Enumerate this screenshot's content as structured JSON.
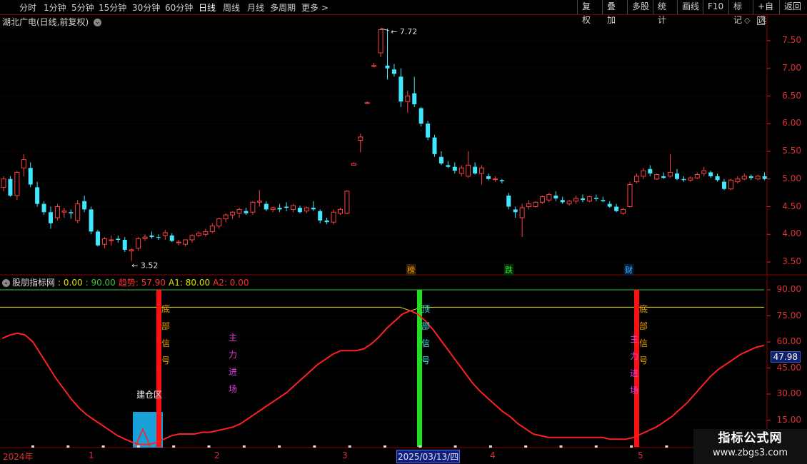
{
  "toolbar": {
    "left_items": [
      "分时",
      "1分钟",
      "5分钟",
      "15分钟",
      "30分钟",
      "60分钟",
      "日线",
      "周线",
      "月线",
      "多周期",
      "更多 >"
    ],
    "active": "日线",
    "right_items": [
      "复权",
      "叠加",
      "多股",
      "统计",
      "画线",
      "F10",
      "标记",
      "+自选",
      "返回"
    ]
  },
  "stock": {
    "title": "湖北广电(日线,前复权)",
    "chevron_icon": "chevron-down-icon",
    "diamond_icon": "diamond-icon"
  },
  "price_axis": {
    "labels": [
      "7.50",
      "7.00",
      "6.50",
      "6.00",
      "5.50",
      "5.00",
      "4.50",
      "4.00",
      "3.50"
    ]
  },
  "price_annotations": {
    "high": "7.72",
    "low": "3.52"
  },
  "event_tags": [
    {
      "text": "榜",
      "color": "#e8a000",
      "bg": "#3a2200"
    },
    {
      "text": "跌",
      "color": "#40e040",
      "bg": "#003000"
    },
    {
      "text": "财",
      "color": "#40c0ff",
      "bg": "#002040"
    }
  ],
  "indicator": {
    "name": "股朋指标网",
    "v0": ": 0.00",
    "v90": ": 90.00",
    "trend_label": "趋势: 57.90",
    "a1_label": "A1: 80.00",
    "a2_label": "A2: 0.00",
    "axis_labels": [
      "90.00",
      "75.00",
      "60.00",
      "45.00",
      "30.00",
      "15.00"
    ],
    "current_value": "47.98",
    "signals": [
      {
        "text": "底部信号",
        "color": "#e8a000"
      },
      {
        "text": "顶部信号",
        "color": "#40e0e0"
      },
      {
        "text": "底部信号",
        "color": "#e8a000"
      }
    ],
    "main_force": "主力进场",
    "main_force_color": "#e040e0",
    "build_zone": "建仓区"
  },
  "colors": {
    "up": "#ff4040",
    "down": "#40e8ff",
    "trend": "#ff2020",
    "buy_bar": "#ff1010",
    "sell_bar": "#20e020",
    "a1": "#e0e000",
    "top_line": "#40c040"
  },
  "date_axis": {
    "labels": [
      "2024年",
      "1",
      "2",
      "3",
      "4",
      "5"
    ],
    "highlight": "2025/03/13/四"
  },
  "watermark": {
    "title": "指标公式网",
    "url": "www.zbgs3.com"
  },
  "chart_data": {
    "type": "candlestick",
    "title": "湖北广电(日线,前复权)",
    "ylim": [
      3.3,
      7.85
    ],
    "candles": [
      [
        4.85,
        5.05,
        4.78,
        5.0
      ],
      [
        5.0,
        5.05,
        4.68,
        4.7
      ],
      [
        4.7,
        5.15,
        4.62,
        5.12
      ],
      [
        5.2,
        5.45,
        5.05,
        5.35
      ],
      [
        5.2,
        5.3,
        4.85,
        4.9
      ],
      [
        4.85,
        4.95,
        4.5,
        4.55
      ],
      [
        4.55,
        4.6,
        4.35,
        4.4
      ],
      [
        4.4,
        4.5,
        4.1,
        4.2
      ],
      [
        4.3,
        4.55,
        4.25,
        4.5
      ],
      [
        4.4,
        4.48,
        4.3,
        4.42
      ],
      [
        4.4,
        4.45,
        4.28,
        4.38
      ],
      [
        4.25,
        4.62,
        4.2,
        4.55
      ],
      [
        4.6,
        4.7,
        4.4,
        4.45
      ],
      [
        4.45,
        4.5,
        4.0,
        4.05
      ],
      [
        4.05,
        4.08,
        3.78,
        3.8
      ],
      [
        3.82,
        3.95,
        3.75,
        3.92
      ],
      [
        3.9,
        3.98,
        3.8,
        3.9
      ],
      [
        3.92,
        3.98,
        3.85,
        3.9
      ],
      [
        3.9,
        3.95,
        3.68,
        3.72
      ],
      [
        3.7,
        3.75,
        3.52,
        3.72
      ],
      [
        3.75,
        3.95,
        3.7,
        3.92
      ],
      [
        3.92,
        4.0,
        3.88,
        3.95
      ],
      [
        3.98,
        4.05,
        3.92,
        3.95
      ],
      [
        3.95,
        4.0,
        3.9,
        3.94
      ],
      [
        3.98,
        4.08,
        3.9,
        4.03
      ],
      [
        3.98,
        4.02,
        3.86,
        3.88
      ],
      [
        3.85,
        3.9,
        3.8,
        3.86
      ],
      [
        3.82,
        3.9,
        3.78,
        3.9
      ],
      [
        3.9,
        4.0,
        3.85,
        3.98
      ],
      [
        3.98,
        4.05,
        3.95,
        4.02
      ],
      [
        4.0,
        4.1,
        3.96,
        4.05
      ],
      [
        4.05,
        4.2,
        4.02,
        4.15
      ],
      [
        4.15,
        4.3,
        4.1,
        4.28
      ],
      [
        4.28,
        4.38,
        4.22,
        4.35
      ],
      [
        4.35,
        4.42,
        4.28,
        4.4
      ],
      [
        4.38,
        4.48,
        4.3,
        4.45
      ],
      [
        4.42,
        4.48,
        4.35,
        4.38
      ],
      [
        4.4,
        4.6,
        4.35,
        4.58
      ],
      [
        4.58,
        4.8,
        4.5,
        4.6
      ],
      [
        4.55,
        4.6,
        4.42,
        4.45
      ],
      [
        4.45,
        4.5,
        4.4,
        4.48
      ],
      [
        4.48,
        4.55,
        4.4,
        4.45
      ],
      [
        4.5,
        4.58,
        4.42,
        4.48
      ],
      [
        4.45,
        4.55,
        4.4,
        4.52
      ],
      [
        4.48,
        4.52,
        4.38,
        4.4
      ],
      [
        4.42,
        4.5,
        4.38,
        4.48
      ],
      [
        4.48,
        4.6,
        4.42,
        4.45
      ],
      [
        4.42,
        4.45,
        4.2,
        4.25
      ],
      [
        4.25,
        4.3,
        4.18,
        4.22
      ],
      [
        4.22,
        4.45,
        4.18,
        4.4
      ],
      [
        4.38,
        4.48,
        4.35,
        4.45
      ],
      [
        4.38,
        4.8,
        4.36,
        4.78
      ],
      [
        5.25,
        5.3,
        5.25,
        5.28
      ],
      [
        5.7,
        5.82,
        5.48,
        5.76
      ],
      [
        6.38,
        6.4,
        6.36,
        6.38
      ],
      [
        7.05,
        7.1,
        7.02,
        7.05
      ],
      [
        7.28,
        7.72,
        7.2,
        7.7
      ],
      [
        7.05,
        7.72,
        6.8,
        7.0
      ],
      [
        6.98,
        7.08,
        6.85,
        6.9
      ],
      [
        6.85,
        7.0,
        6.3,
        6.4
      ],
      [
        6.4,
        6.6,
        6.2,
        6.5
      ],
      [
        6.55,
        6.85,
        6.3,
        6.35
      ],
      [
        6.28,
        6.3,
        5.95,
        6.0
      ],
      [
        6.0,
        6.05,
        5.7,
        5.75
      ],
      [
        5.75,
        5.8,
        5.4,
        5.45
      ],
      [
        5.4,
        5.5,
        5.25,
        5.28
      ],
      [
        5.25,
        5.32,
        5.2,
        5.22
      ],
      [
        5.22,
        5.3,
        5.1,
        5.15
      ],
      [
        5.1,
        5.25,
        5.05,
        5.2
      ],
      [
        5.05,
        5.5,
        5.02,
        5.25
      ],
      [
        5.22,
        5.3,
        5.08,
        5.1
      ],
      [
        5.1,
        5.25,
        4.9,
        5.2
      ],
      [
        5.05,
        5.1,
        4.98,
        5.0
      ],
      [
        5.0,
        5.05,
        4.95,
        5.0
      ],
      [
        4.98,
        5.0,
        4.92,
        4.96
      ],
      [
        4.7,
        4.75,
        4.45,
        4.5
      ],
      [
        4.45,
        4.5,
        4.3,
        4.4
      ],
      [
        4.3,
        4.55,
        3.95,
        4.48
      ],
      [
        4.5,
        4.62,
        4.45,
        4.55
      ],
      [
        4.5,
        4.6,
        4.48,
        4.58
      ],
      [
        4.58,
        4.7,
        4.55,
        4.68
      ],
      [
        4.62,
        4.75,
        4.58,
        4.72
      ],
      [
        4.7,
        4.78,
        4.6,
        4.65
      ],
      [
        4.62,
        4.68,
        4.55,
        4.58
      ],
      [
        4.55,
        4.62,
        4.52,
        4.6
      ],
      [
        4.6,
        4.7,
        4.55,
        4.65
      ],
      [
        4.65,
        4.72,
        4.58,
        4.62
      ],
      [
        4.6,
        4.7,
        4.58,
        4.68
      ],
      [
        4.66,
        4.72,
        4.6,
        4.64
      ],
      [
        4.62,
        4.68,
        4.58,
        4.6
      ],
      [
        4.55,
        4.6,
        4.48,
        4.5
      ],
      [
        4.5,
        4.55,
        4.4,
        4.42
      ],
      [
        4.38,
        4.48,
        4.35,
        4.45
      ],
      [
        4.5,
        4.95,
        4.48,
        4.9
      ],
      [
        4.95,
        5.1,
        4.92,
        5.05
      ],
      [
        5.05,
        5.2,
        5.0,
        5.15
      ],
      [
        5.18,
        5.25,
        5.05,
        5.1
      ],
      [
        5.0,
        5.1,
        4.98,
        5.08
      ],
      [
        5.05,
        5.12,
        5.0,
        5.02
      ],
      [
        5.05,
        5.45,
        5.02,
        5.12
      ],
      [
        5.1,
        5.18,
        4.98,
        5.0
      ],
      [
        5.0,
        5.05,
        4.95,
        4.98
      ],
      [
        4.98,
        5.05,
        4.95,
        5.02
      ],
      [
        5.02,
        5.12,
        5.0,
        5.08
      ],
      [
        5.1,
        5.22,
        5.05,
        5.15
      ],
      [
        5.12,
        5.15,
        5.02,
        5.05
      ],
      [
        5.05,
        5.1,
        4.95,
        4.98
      ],
      [
        4.95,
        5.0,
        4.8,
        4.82
      ],
      [
        4.82,
        5.0,
        4.8,
        4.98
      ],
      [
        4.95,
        5.05,
        4.92,
        5.0
      ],
      [
        5.0,
        5.1,
        4.98,
        5.05
      ],
      [
        5.05,
        5.08,
        4.98,
        5.02
      ],
      [
        5.0,
        5.08,
        4.98,
        5.05
      ],
      [
        5.05,
        5.12,
        4.98,
        5.0
      ]
    ],
    "indicator_series": {
      "name": "趋势",
      "values": [
        62,
        64,
        65,
        64,
        60,
        53,
        46,
        39,
        33,
        27,
        22,
        18,
        15,
        12,
        9,
        6,
        4,
        2,
        1,
        1,
        2,
        4,
        6,
        7,
        7,
        7,
        8,
        8,
        9,
        10,
        11,
        13,
        16,
        19,
        22,
        25,
        28,
        31,
        35,
        39,
        43,
        47,
        50,
        53,
        55,
        55,
        55,
        56,
        59,
        63,
        68,
        72,
        76,
        78,
        76,
        72,
        67,
        61,
        55,
        49,
        43,
        37,
        32,
        28,
        24,
        20,
        17,
        13,
        10,
        7,
        6,
        5,
        5,
        5,
        5,
        5,
        5,
        5,
        5,
        4,
        4,
        4,
        5,
        7,
        9,
        11,
        14,
        17,
        21,
        25,
        30,
        35,
        40,
        44,
        47,
        50,
        53,
        55,
        57,
        58
      ],
      "A1": 80,
      "A2": 0,
      "top": 90,
      "ylim": [
        -5,
        95
      ]
    }
  }
}
